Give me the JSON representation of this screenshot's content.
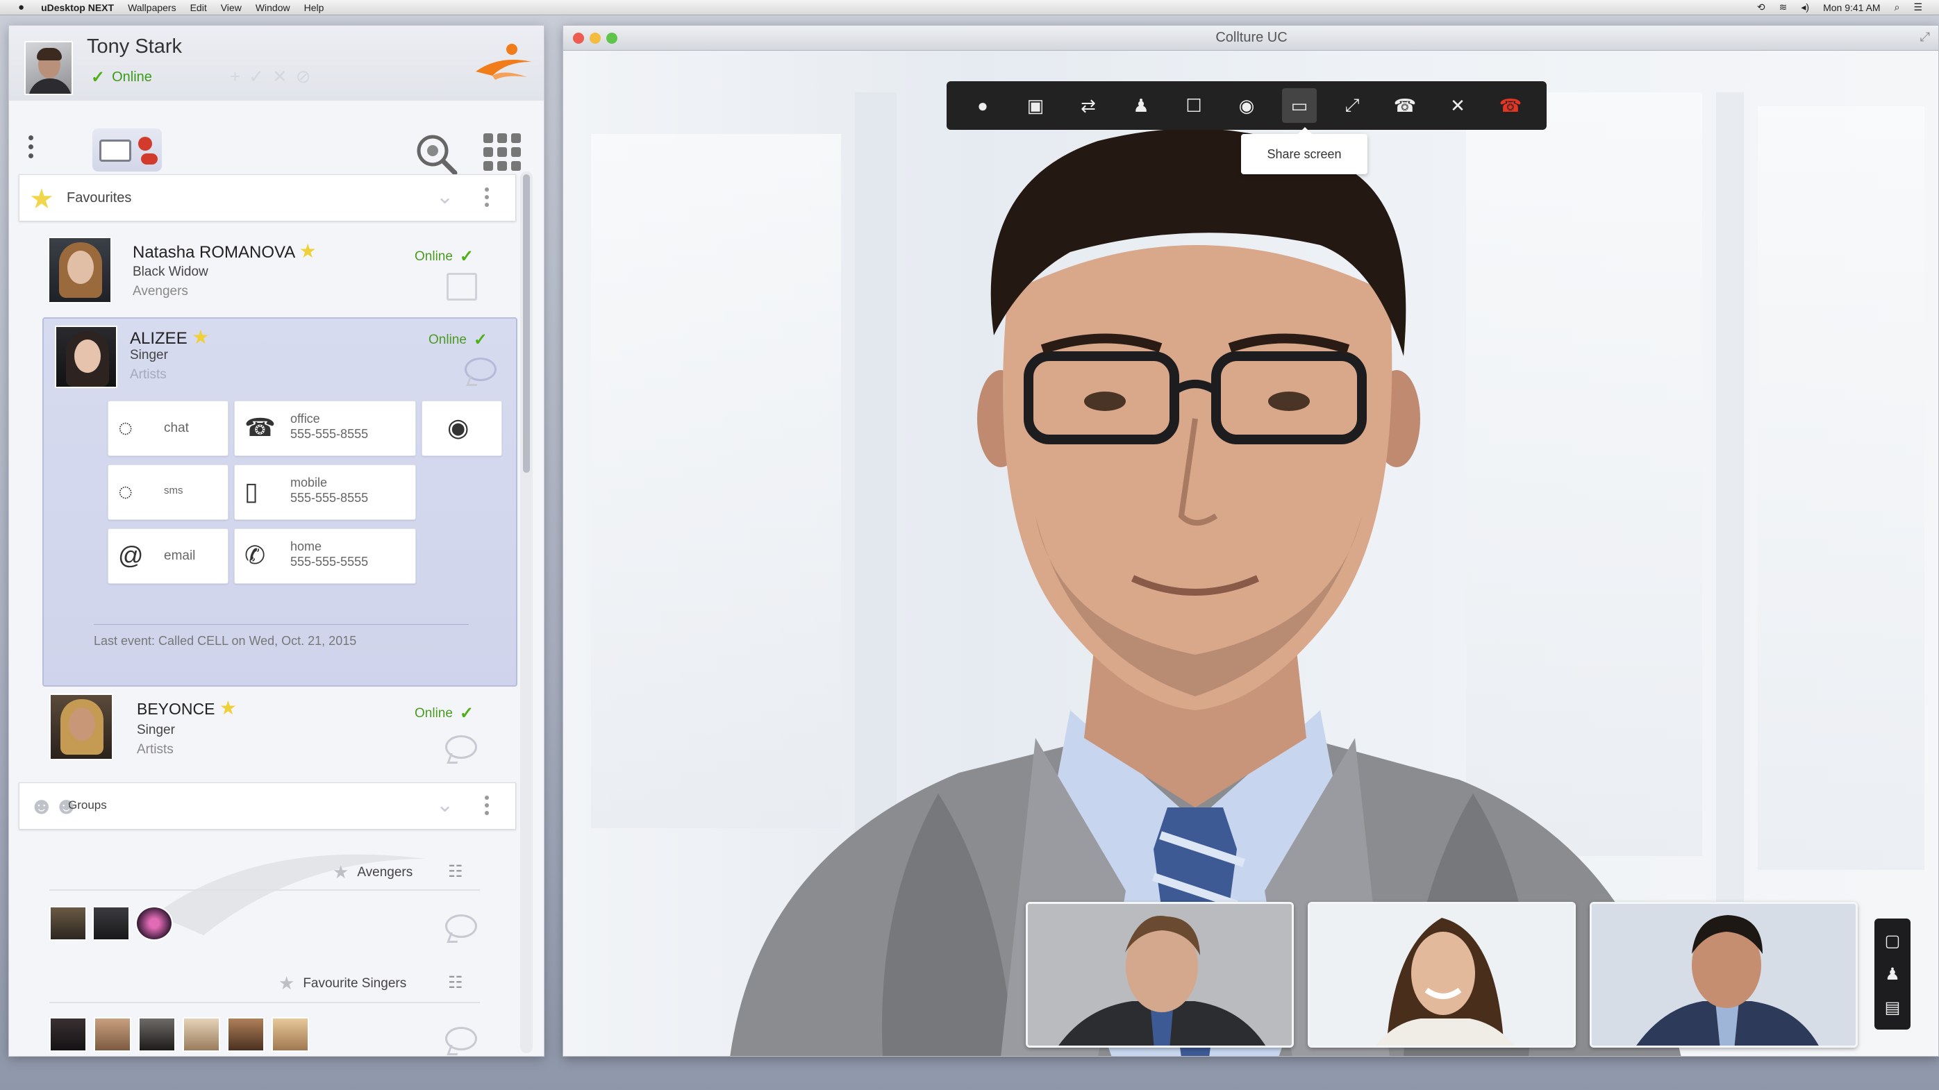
{
  "menubar": {
    "apple": "",
    "app": "uDesktop NEXT",
    "items": [
      "Wallpapers",
      "Edit",
      "View",
      "Window",
      "Help"
    ],
    "clock": "Mon 9:41 AM"
  },
  "profile": {
    "name": "Tony Stark",
    "status": "Online"
  },
  "favourites": {
    "label": "Favourites",
    "contacts": [
      {
        "name": "Natasha ROMANOVA",
        "title": "Black Widow",
        "group": "Avengers",
        "status": "Online"
      },
      {
        "name": "ALIZEE",
        "title": "Singer",
        "group": "Artists",
        "status": "Online"
      },
      {
        "name": "BEYONCE",
        "title": "Singer",
        "group": "Artists",
        "status": "Online"
      }
    ]
  },
  "expanded": {
    "chat": "chat",
    "office_label": "office",
    "office_number": "555-555-8555",
    "sms": "sms",
    "mobile_label": "mobile",
    "mobile_number": "555-555-8555",
    "email": "email",
    "home_label": "home",
    "home_number": "555-555-5555",
    "last_event": "Last event: Called CELL on Wed, Oct. 21, 2015"
  },
  "groups": {
    "label": "Groups",
    "items": [
      {
        "name": "Avengers"
      },
      {
        "name": "Favourite Singers"
      }
    ]
  },
  "video": {
    "window_title": "Collture UC",
    "tooltip": "Share screen"
  },
  "colors": {
    "online": "#4a9b1f",
    "accent_orange": "#f07c1a",
    "hangup": "#e53525",
    "selected_bg": "#d4d8ee"
  }
}
